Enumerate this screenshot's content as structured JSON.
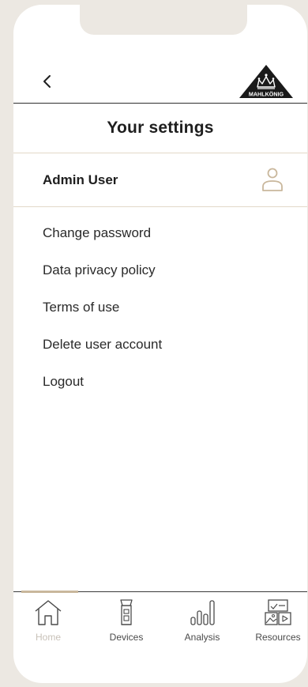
{
  "header": {
    "back_icon": "chevron-left-icon",
    "logo_text": "MAHLKÖNIG"
  },
  "page": {
    "title": "Your settings"
  },
  "user": {
    "name": "Admin User",
    "icon": "user-icon"
  },
  "menu": {
    "items": [
      {
        "label": "Change password"
      },
      {
        "label": "Data privacy policy"
      },
      {
        "label": "Terms of use"
      },
      {
        "label": "Delete user account"
      },
      {
        "label": "Logout"
      }
    ]
  },
  "tabbar": {
    "active_tab": "Home",
    "tabs": [
      {
        "label": "Home",
        "icon": "home-icon"
      },
      {
        "label": "Devices",
        "icon": "grinder-icon"
      },
      {
        "label": "Analysis",
        "icon": "bar-chart-icon"
      },
      {
        "label": "Resources",
        "icon": "media-library-icon"
      }
    ]
  },
  "colors": {
    "accent": "#c9b79c",
    "divider": "#e3d8c8",
    "background": "#ece8e2",
    "text": "#1e1e1e"
  }
}
